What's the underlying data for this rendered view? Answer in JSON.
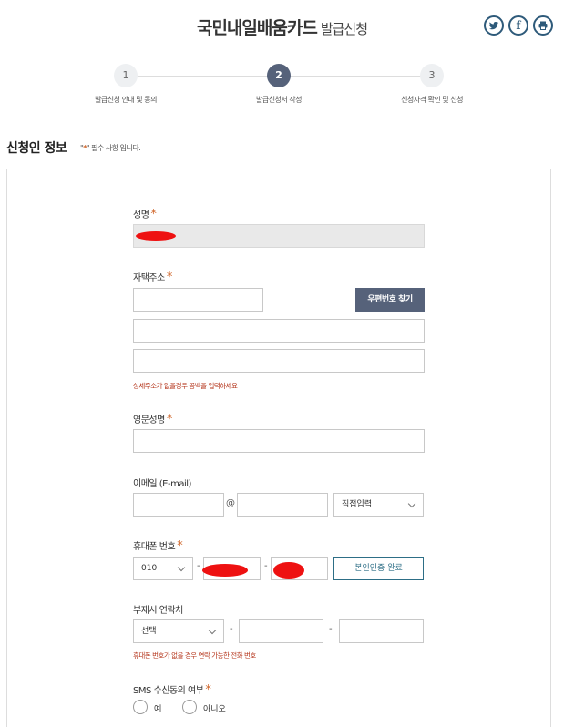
{
  "header": {
    "title_main": "국민내일배움카드",
    "title_sub": "발급신청"
  },
  "share": {
    "twitter": "twitter-icon",
    "facebook": "facebook-icon",
    "print": "print-icon"
  },
  "steps": [
    {
      "num": "1",
      "label": "발급신청 안내 및 동의"
    },
    {
      "num": "2",
      "label": "발급신청서 작성"
    },
    {
      "num": "3",
      "label": "신청자격 확인 및 신청"
    }
  ],
  "section": {
    "title": "신청인 정보",
    "note_pre": "\"",
    "note_star": "*",
    "note_post": "\" 필수 사항 입니다."
  },
  "form": {
    "name_label": "성명",
    "address_label": "자택주소",
    "zip_button": "우편번호 찾기",
    "address_hint": "상세주소가 없을경우 공백을 입력하세요",
    "eng_name_label": "영문성명",
    "email_label": "이메일 (E-mail)",
    "email_at": "@",
    "email_domain_select": "직접입력",
    "phone_label": "휴대폰 번호",
    "phone_prefix": "010",
    "phone_dash": "-",
    "verify_button": "본인인증 완료",
    "alt_contact_label": "부재시 연락처",
    "alt_contact_select": "선택",
    "alt_contact_hint": "휴대폰 번호가 없을 경우 연락 가능한 전화 번호",
    "sms_label": "SMS 수신동의 여부",
    "sms_yes": "예",
    "sms_no": "아니오",
    "required_mark": "*"
  },
  "colors": {
    "accent": "#56627a",
    "required": "#d0662a",
    "hint": "#b5361c",
    "verify": "#2d6e86"
  }
}
